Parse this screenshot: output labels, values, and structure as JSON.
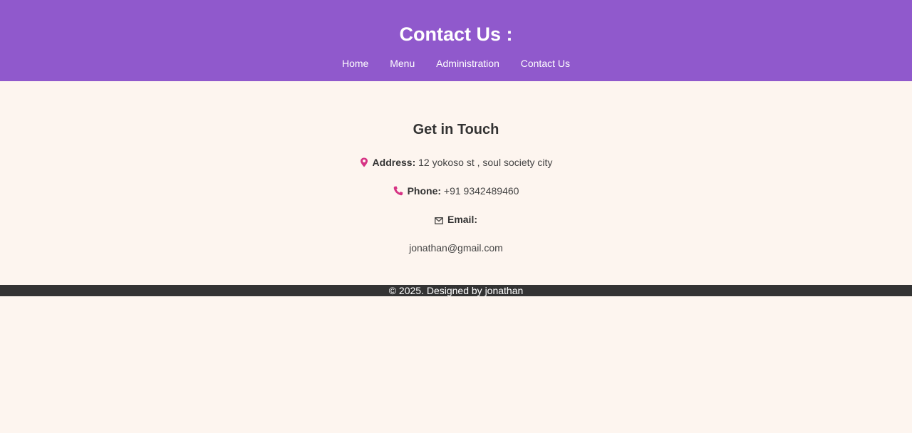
{
  "header": {
    "title": "Contact Us :",
    "nav": [
      {
        "label": "Home"
      },
      {
        "label": "Menu"
      },
      {
        "label": "Administration"
      },
      {
        "label": "Contact Us"
      }
    ]
  },
  "contact": {
    "heading": "Get in Touch",
    "address": {
      "icon": "pin-icon",
      "label": "Address:",
      "value": "12 yokoso st , soul society city"
    },
    "phone": {
      "icon": "phone-icon",
      "label": "Phone:",
      "value": "+91 9342489460"
    },
    "email": {
      "icon": "envelope-icon",
      "label": "Email:",
      "value": "jonathan@gmail.com"
    }
  },
  "footer": {
    "text": "© 2025. Designed by jonathan"
  },
  "colors": {
    "header_bg": "#9059cc",
    "page_bg": "#fdf5ef",
    "footer_bg": "#333333",
    "icon_accent": "#d63384"
  }
}
